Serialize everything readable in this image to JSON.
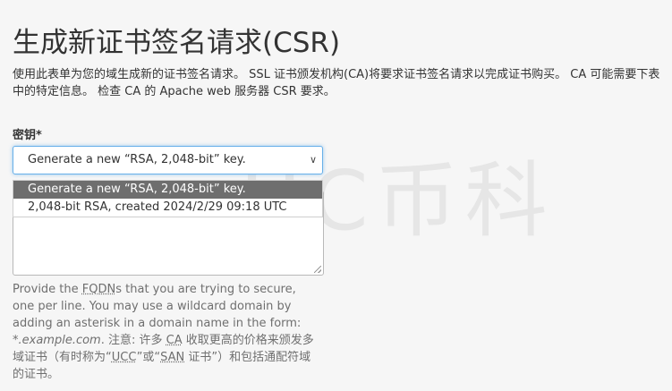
{
  "page": {
    "title": "生成新证书签名请求(CSR)",
    "intro": "使用此表单为您的域生成新的证书签名请求。 SSL 证书颁发机构(CA)将要求证书签名请求以完成证书购买。 CA 可能需要下表中的特定信息。 检查 CA 的 Apache web 服务器 CSR 要求。",
    "watermark": "ЦC币科"
  },
  "key_field": {
    "label": "密钥*",
    "selected_value": "Generate a new “RSA, 2,048-bit” key.",
    "options": [
      "Generate a new “RSA, 2,048-bit” key.",
      "2,048-bit RSA, created 2024/2/29 09:18 UTC"
    ]
  },
  "domains_field": {
    "value": ""
  },
  "help": {
    "p1": "Provide the ",
    "fqdn": "FQDN",
    "p2": "s that you are trying to secure, one per line. You may use a wildcard domain by adding an asterisk in a domain name in the form: ",
    "example": "*.example.com",
    "p3": ". 注意: 许多 ",
    "ca": "CA",
    "p4": " 收取更高的价格来颁发多域证书（有时称为“",
    "ucc": "UCC",
    "p5": "”或“",
    "san": "SAN",
    "p6": " 证书”）和包括通配符域的证书。"
  }
}
